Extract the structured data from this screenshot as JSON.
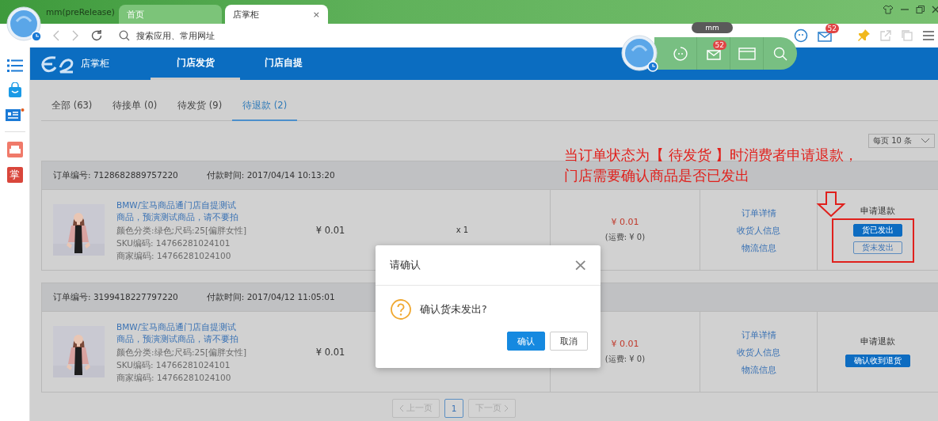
{
  "browser": {
    "profile": "mm(preRelease)",
    "tabs": [
      {
        "label": "首页",
        "selected": false
      },
      {
        "label": "店掌柜",
        "selected": true
      }
    ],
    "tab_close": "×",
    "address_placeholder": "搜索应用、常用网址",
    "mail_badge": "52"
  },
  "floating_widget": {
    "tooltip": "mm",
    "mail_badge": "52"
  },
  "sidebar": {
    "app_label": "掌"
  },
  "app_header": {
    "title": "店掌柜",
    "nav": [
      {
        "label": "门店发货",
        "selected": true
      },
      {
        "label": "门店自提",
        "selected": false
      }
    ]
  },
  "filter_tabs": [
    {
      "label": "全部 (63)",
      "selected": false
    },
    {
      "label": "待接单 (0)",
      "selected": false
    },
    {
      "label": "待发货 (9)",
      "selected": false
    },
    {
      "label": "待退款 (2)",
      "selected": true
    }
  ],
  "page_size": "每页 10 条",
  "orders": [
    {
      "order_no": "订单编号: 7128682889757220",
      "paid_time": "付款时间: 2017/04/14 10:13:20",
      "title": "BMW/宝马商品通门店自提测试商品，预演测试商品，请不要拍",
      "specs": [
        "颜色分类:绿色;尺码:25[偏胖女性]",
        "SKU编码: 14766281024101",
        "商家编码: 14766281024100"
      ],
      "price": "¥ 0.01",
      "qty": "x 1",
      "total": "¥ 0.01",
      "shipping": "(运费: ¥ 0)",
      "links": [
        "订单详情",
        "收货人信息",
        "物流信息"
      ],
      "status": "申请退款",
      "actions": [
        {
          "label": "货已发出",
          "kind": "primary"
        },
        {
          "label": "货未发出",
          "kind": "outline"
        }
      ]
    },
    {
      "order_no": "订单编号: 3199418227797220",
      "paid_time": "付款时间: 2017/04/12 11:05:01",
      "title": "BMW/宝马商品通门店自提测试商品，预演测试商品，请不要拍",
      "specs": [
        "颜色分类:绿色;尺码:25[偏胖女性]",
        "SKU编码: 14766281024101",
        "商家编码: 14766281024100"
      ],
      "price": "¥ 0.01",
      "total": "¥ 0.01",
      "shipping": "(运费: ¥ 0)",
      "links": [
        "订单详情",
        "收货人信息",
        "物流信息"
      ],
      "status": "申请退款",
      "actions": [
        {
          "label": "确认收到退货",
          "kind": "primary"
        }
      ]
    }
  ],
  "pagination": {
    "prev": "上一页",
    "prev_disabled": true,
    "pages": [
      {
        "label": "1",
        "selected": true
      }
    ],
    "next": "下一页",
    "next_disabled": true
  },
  "annotation": {
    "lines": [
      "当订单状态为【 待发货 】时消费者申请退款，",
      "门店需要确认商品是否已发出"
    ]
  },
  "dialog": {
    "title": "请确认",
    "close": "×",
    "message": "确认货未发出?",
    "buttons": [
      {
        "label": "确认",
        "kind": "primary"
      },
      {
        "label": "取消",
        "kind": "default"
      }
    ]
  }
}
